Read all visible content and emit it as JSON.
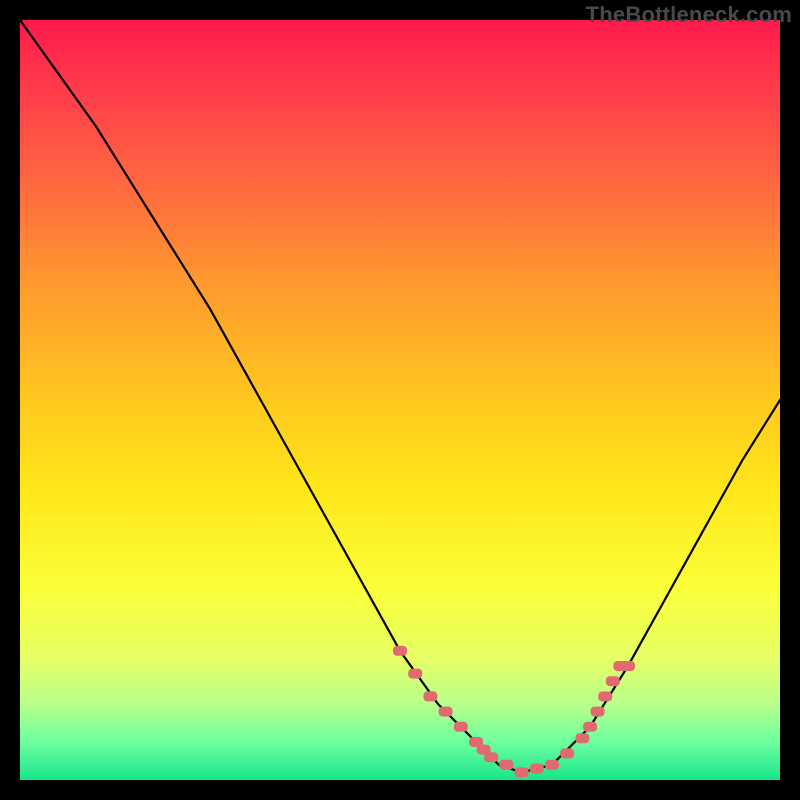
{
  "watermark": "TheBottleneck.com",
  "colors": {
    "gradient_top": "#ff1a4d",
    "gradient_bottom": "#17e68a",
    "curve": "#000000",
    "marker": "#e16a6f",
    "frame_bg": "#000000"
  },
  "chart_data": {
    "type": "line",
    "title": "",
    "xlabel": "",
    "ylabel": "",
    "xlim": [
      0,
      100
    ],
    "ylim": [
      0,
      100
    ],
    "x": [
      0,
      5,
      10,
      15,
      20,
      25,
      30,
      35,
      40,
      45,
      50,
      55,
      60,
      63,
      66,
      70,
      75,
      80,
      85,
      90,
      95,
      100
    ],
    "values": [
      100,
      93,
      86,
      78,
      70,
      62,
      53,
      44,
      35,
      26,
      17,
      10,
      5,
      2,
      1,
      2,
      7,
      15,
      24,
      33,
      42,
      50
    ],
    "series": [
      {
        "name": "bottleneck-curve",
        "x": [
          0,
          5,
          10,
          15,
          20,
          25,
          30,
          35,
          40,
          45,
          50,
          55,
          60,
          63,
          66,
          70,
          75,
          80,
          85,
          90,
          95,
          100
        ],
        "y": [
          100,
          93,
          86,
          78,
          70,
          62,
          53,
          44,
          35,
          26,
          17,
          10,
          5,
          2,
          1,
          2,
          7,
          15,
          24,
          33,
          42,
          50
        ]
      }
    ],
    "markers": {
      "name": "highlight-band",
      "x": [
        50,
        52,
        54,
        56,
        58,
        60,
        61,
        62,
        64,
        66,
        68,
        70,
        72,
        74,
        75,
        76,
        77,
        78,
        79,
        80
      ],
      "y": [
        17,
        14,
        11,
        9,
        7,
        5,
        4,
        3,
        2,
        1,
        1.5,
        2,
        3.5,
        5.5,
        7,
        9,
        11,
        13,
        15,
        15
      ]
    }
  }
}
